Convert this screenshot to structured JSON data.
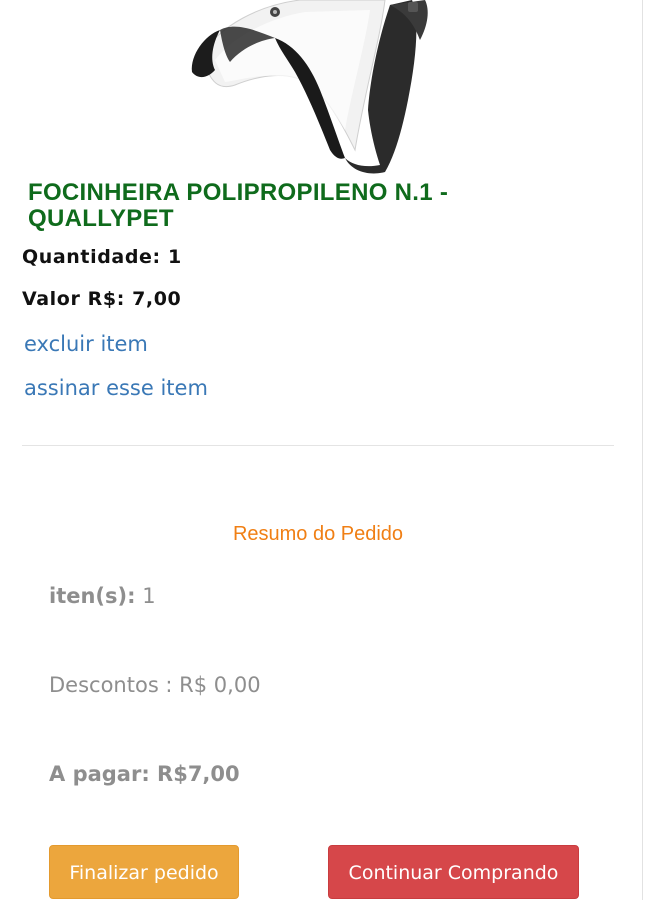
{
  "product": {
    "name": "FOCINHEIRA POLIPROPILENO N.1 - QUALLYPET",
    "quantity_text": "Quantidade: 1",
    "price_text": "Valor R$: 7,00",
    "remove_link": "excluir item",
    "subscribe_link": "assinar esse item",
    "image_icon": "muzzle-product-photo"
  },
  "summary": {
    "title": "Resumo do Pedido",
    "items_label": "iten(s):",
    "items_value": " 1",
    "discounts_text": "Descontos : R$ 0,00",
    "total_text": "A pagar: R$7,00"
  },
  "actions": {
    "checkout_label": "Finalizar pedido",
    "continue_label": "Continuar Comprando"
  },
  "colors": {
    "title_green": "#0f6b1c",
    "link_blue": "#3a78b6",
    "summary_orange": "#f07f14",
    "checkout_button": "#eca63d",
    "continue_button": "#d6474a"
  }
}
